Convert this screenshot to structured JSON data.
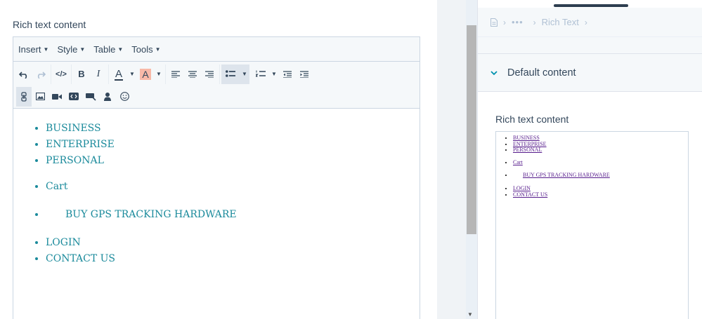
{
  "editor": {
    "label": "Rich text content",
    "menu": [
      "Insert",
      "Style",
      "Table",
      "Tools"
    ],
    "content": {
      "group1": [
        "BUSINESS",
        "ENTERPRISE",
        "PERSONAL"
      ],
      "group2": [
        "Cart"
      ],
      "group3": [
        "BUY GPS TRACKING HARDWARE"
      ],
      "group4": [
        "LOGIN",
        "CONTACT US"
      ]
    }
  },
  "sidebar": {
    "breadcrumb": {
      "ellipsis": "•••",
      "current": "Rich Text"
    },
    "section_title": "Default content",
    "preview_label": "Rich text content"
  },
  "colors": {
    "link": "#1a8a9b",
    "accent": "#0091ae",
    "preview_link": "#551a8b"
  }
}
